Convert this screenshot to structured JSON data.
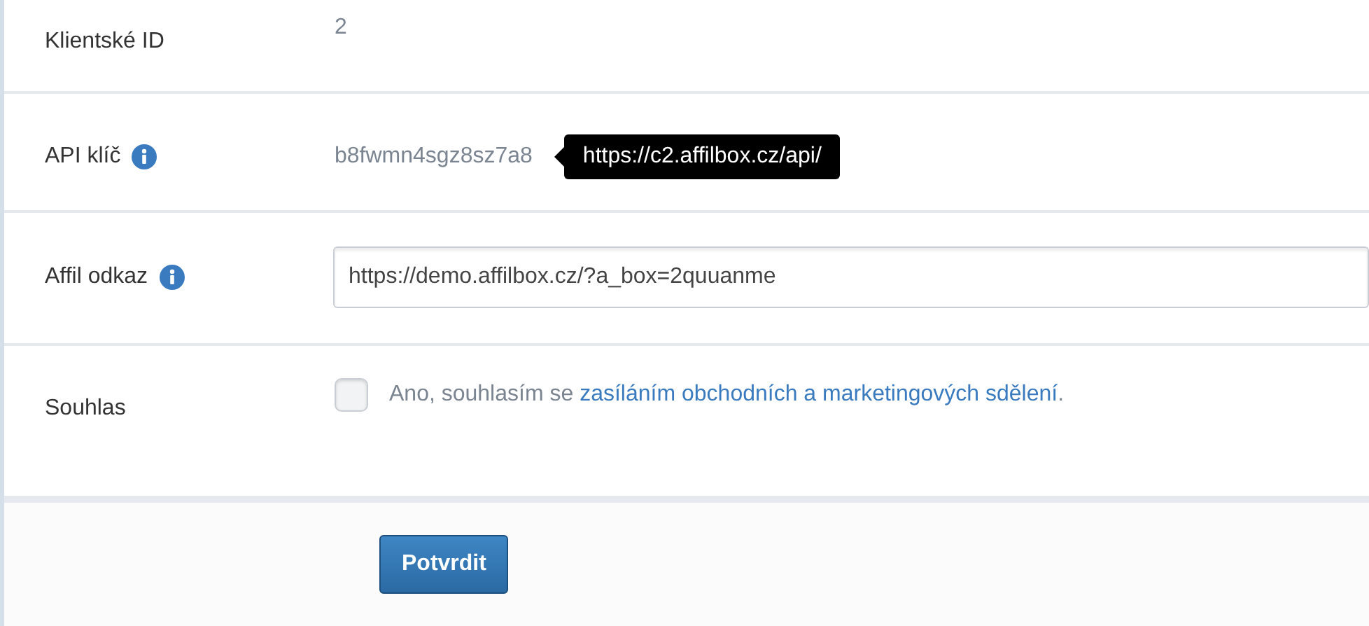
{
  "rows": [
    {
      "kind": "text",
      "label": "Klientské ID",
      "info": false,
      "value": "2"
    },
    {
      "kind": "text",
      "label": "API klíč",
      "info": true,
      "value": "b8fwmn4sgz8sz7a8",
      "tooltip": "https://c2.affilbox.cz/api/"
    },
    {
      "kind": "input",
      "label": "Affil odkaz",
      "info": true,
      "value": "https://demo.affilbox.cz/?a_box=2quuanme"
    },
    {
      "kind": "checkbox",
      "label": "Souhlas",
      "info": false,
      "checked": false,
      "text": "Ano, souhlasím se",
      "link": "zasíláním obchodních a marketingových sdělení",
      "text_after": "."
    }
  ],
  "submit": "Potvrdit"
}
